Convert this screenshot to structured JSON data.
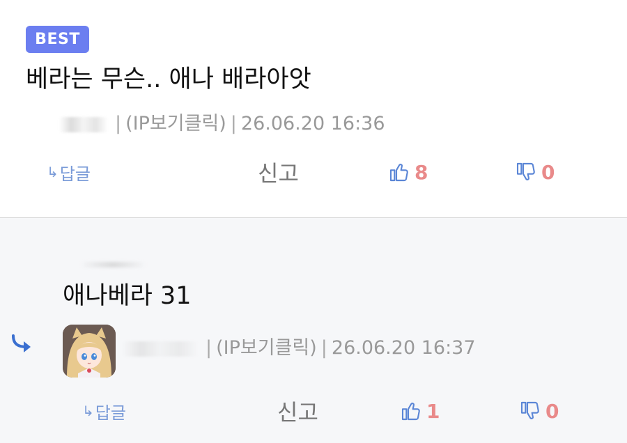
{
  "best_comment": {
    "badge": "BEST",
    "text": "베라는 무슨.. 애나 배라아앗",
    "ip_label": "(IP보기클릭)",
    "date": "26.06.20 16:36",
    "reply_label": "답글",
    "report_label": "신고",
    "likes": "8",
    "dislikes": "0"
  },
  "reply_comment": {
    "text": "애나베라 31",
    "ip_label": "(IP보기클릭)",
    "date": "26.06.20 16:37",
    "reply_label": "답글",
    "report_label": "신고",
    "likes": "1",
    "dislikes": "0"
  },
  "colors": {
    "badge": "#6b7ef0",
    "link": "#7a9bd8",
    "vote": "#e98a8a",
    "icon": "#5b86d6",
    "reply_bg": "#f6f7f9"
  },
  "icons": [
    "reply-arrow-icon",
    "thumbs-up-icon",
    "thumbs-down-icon",
    "avatar-image"
  ]
}
